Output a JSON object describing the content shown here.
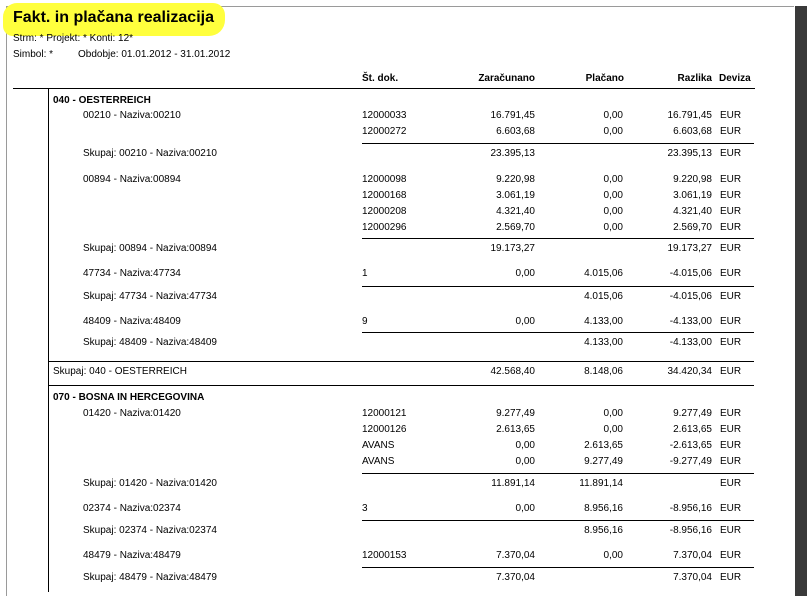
{
  "report": {
    "title": "Fakt. in plačana realizacija",
    "filter_line1": "Strm: *     Projekt: *   Konti: 12*",
    "filter_simbol": "Simbol: *",
    "filter_obdobje": "Obdobje: 01.01.2012 - 31.01.2012"
  },
  "columns": {
    "dok": "Št. dok.",
    "zaracunano": "Zaračunano",
    "placano": "Plačano",
    "razlika": "Razlika",
    "deviza": "Deviza"
  },
  "rows": [
    {
      "kind": "group",
      "label": "040   - OESTERREICH"
    },
    {
      "kind": "data",
      "label": "00210 - Naziva:00210",
      "dok": "12000033",
      "zar": "16.791,45",
      "pla": "0,00",
      "raz": "16.791,45",
      "dev": "EUR"
    },
    {
      "kind": "data",
      "label": "",
      "dok": "12000272",
      "zar": "6.603,68",
      "pla": "0,00",
      "raz": "6.603,68",
      "dev": "EUR"
    },
    {
      "kind": "sub",
      "label": "Skupaj:   00210 - Naziva:00210",
      "zar": "23.395,13",
      "pla": "",
      "raz": "23.395,13",
      "dev": "EUR"
    },
    {
      "kind": "data",
      "label": "00894 - Naziva:00894",
      "dok": "12000098",
      "zar": "9.220,98",
      "pla": "0,00",
      "raz": "9.220,98",
      "dev": "EUR"
    },
    {
      "kind": "data",
      "label": "",
      "dok": "12000168",
      "zar": "3.061,19",
      "pla": "0,00",
      "raz": "3.061,19",
      "dev": "EUR"
    },
    {
      "kind": "data",
      "label": "",
      "dok": "12000208",
      "zar": "4.321,40",
      "pla": "0,00",
      "raz": "4.321,40",
      "dev": "EUR"
    },
    {
      "kind": "data",
      "label": "",
      "dok": "12000296",
      "zar": "2.569,70",
      "pla": "0,00",
      "raz": "2.569,70",
      "dev": "EUR"
    },
    {
      "kind": "sub",
      "label": "Skupaj:   00894 - Naziva:00894",
      "zar": "19.173,27",
      "pla": "",
      "raz": "19.173,27",
      "dev": "EUR"
    },
    {
      "kind": "data",
      "label": "47734 - Naziva:47734",
      "dok": "1",
      "zar": "0,00",
      "pla": "4.015,06",
      "raz": "-4.015,06",
      "dev": "EUR"
    },
    {
      "kind": "sub",
      "label": "Skupaj:   47734 - Naziva:47734",
      "zar": "",
      "pla": "4.015,06",
      "raz": "-4.015,06",
      "dev": "EUR"
    },
    {
      "kind": "data",
      "label": "48409 - Naziva:48409",
      "dok": "9",
      "zar": "0,00",
      "pla": "4.133,00",
      "raz": "-4.133,00",
      "dev": "EUR"
    },
    {
      "kind": "sub",
      "label": "Skupaj:   48409 - Naziva:48409",
      "zar": "",
      "pla": "4.133,00",
      "raz": "-4.133,00",
      "dev": "EUR"
    },
    {
      "kind": "gsub",
      "label": "Skupaj:  040   - OESTERREICH",
      "zar": "42.568,40",
      "pla": "8.148,06",
      "raz": "34.420,34",
      "dev": "EUR"
    },
    {
      "kind": "group",
      "label": "070   - BOSNA IN HERCEGOVINA"
    },
    {
      "kind": "data",
      "label": "01420 - Naziva:01420",
      "dok": "12000121",
      "zar": "9.277,49",
      "pla": "0,00",
      "raz": "9.277,49",
      "dev": "EUR"
    },
    {
      "kind": "data",
      "label": "",
      "dok": "12000126",
      "zar": "2.613,65",
      "pla": "0,00",
      "raz": "2.613,65",
      "dev": "EUR"
    },
    {
      "kind": "data",
      "label": "",
      "dok": "AVANS",
      "zar": "0,00",
      "pla": "2.613,65",
      "raz": "-2.613,65",
      "dev": "EUR"
    },
    {
      "kind": "data",
      "label": "",
      "dok": "AVANS",
      "zar": "0,00",
      "pla": "9.277,49",
      "raz": "-9.277,49",
      "dev": "EUR"
    },
    {
      "kind": "sub",
      "label": "Skupaj:   01420 - Naziva:01420",
      "zar": "11.891,14",
      "pla": "11.891,14",
      "raz": "",
      "dev": "EUR"
    },
    {
      "kind": "data",
      "label": "02374 - Naziva:02374",
      "dok": "3",
      "zar": "0,00",
      "pla": "8.956,16",
      "raz": "-8.956,16",
      "dev": "EUR"
    },
    {
      "kind": "sub",
      "label": "Skupaj:   02374 - Naziva:02374",
      "zar": "",
      "pla": "8.956,16",
      "raz": "-8.956,16",
      "dev": "EUR"
    },
    {
      "kind": "data",
      "label": "48479 - Naziva:48479",
      "dok": "12000153",
      "zar": "7.370,04",
      "pla": "0,00",
      "raz": "7.370,04",
      "dev": "EUR"
    },
    {
      "kind": "sub",
      "label": "Skupaj:   48479 - Naziva:48479",
      "zar": "7.370,04",
      "pla": "",
      "raz": "7.370,04",
      "dev": "EUR"
    }
  ]
}
